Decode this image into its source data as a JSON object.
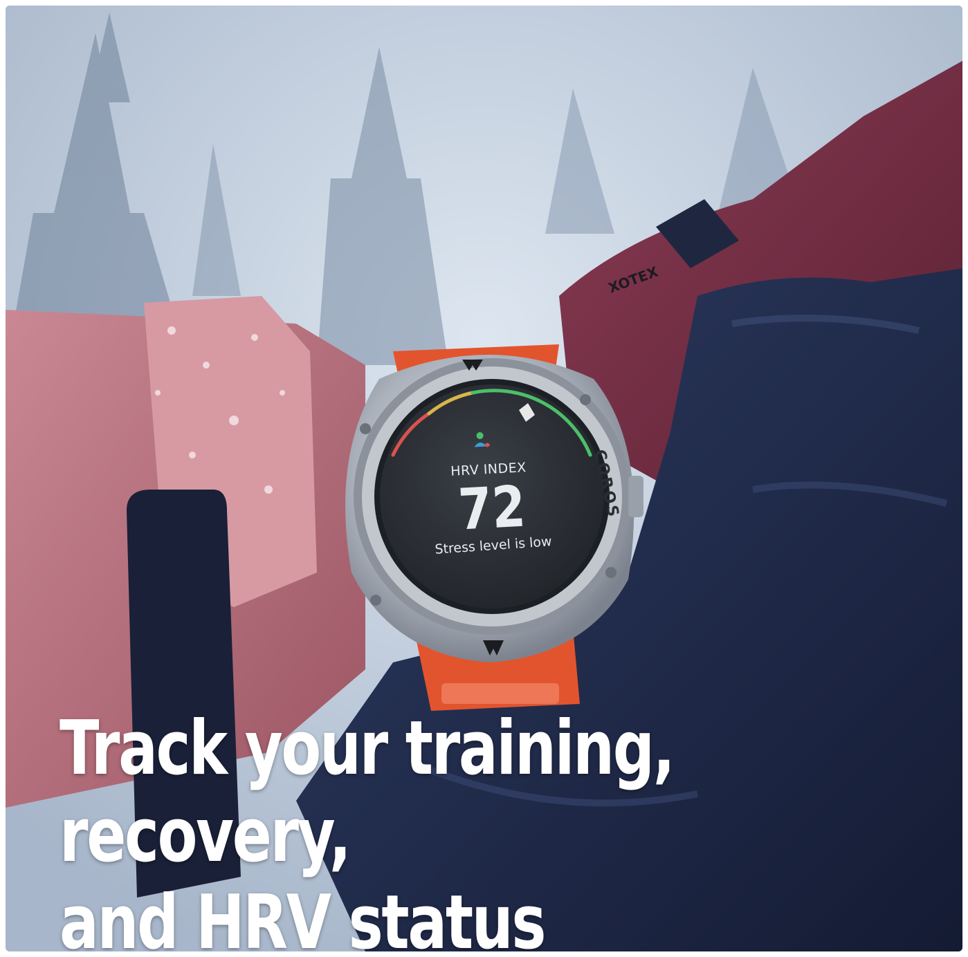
{
  "headline": {
    "line1": "Track your training, recovery,",
    "line2": "and HRV status"
  },
  "watch": {
    "brand": "COROS",
    "metric_label": "HRV INDEX",
    "metric_value": "72",
    "status_text": "Stress level is low",
    "icon": "person-heart-icon"
  },
  "glove": {
    "brand": "XOTEX"
  },
  "colors": {
    "sky": "#c9d6e6",
    "sleeve": "#c07a85",
    "glove_leather": "#7a3148",
    "glove_navy": "#1f2a4a",
    "strap_orange": "#e2542e",
    "bezel": "#b9bec6",
    "screen": "#2b2f35",
    "gauge_red": "#d9534f",
    "gauge_yellow": "#d9b64a",
    "gauge_green": "#4cbf6a",
    "headline_text": "#ffffff"
  }
}
